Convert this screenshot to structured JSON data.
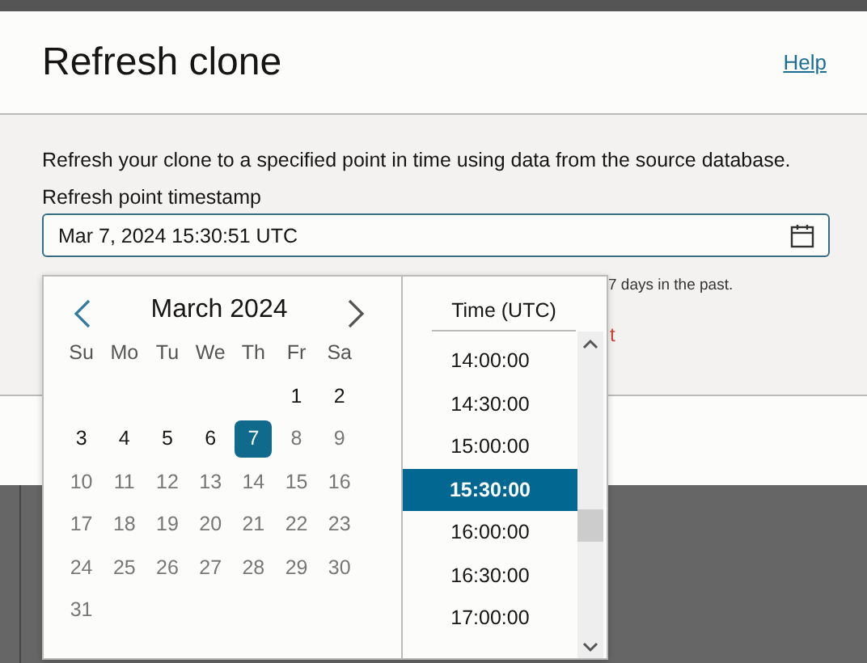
{
  "dialog": {
    "title": "Refresh clone",
    "help_link": "Help"
  },
  "description": "Refresh your clone to a specified point in time using data from the source database.",
  "field": {
    "label": "Refresh point timestamp",
    "value": "Mar 7, 2024 15:30:51 UTC"
  },
  "hint_fragment": "7 days in the past.",
  "error_fragment": "t",
  "calendar": {
    "month": "March 2024",
    "weekdays": [
      "Su",
      "Mo",
      "Tu",
      "We",
      "Th",
      "Fr",
      "Sa"
    ],
    "days": [
      {
        "label": "1",
        "disabled": false,
        "selected": false
      },
      {
        "label": "2",
        "disabled": false,
        "selected": false
      },
      {
        "label": "3",
        "disabled": false,
        "selected": false
      },
      {
        "label": "4",
        "disabled": false,
        "selected": false
      },
      {
        "label": "5",
        "disabled": false,
        "selected": false
      },
      {
        "label": "6",
        "disabled": false,
        "selected": false
      },
      {
        "label": "7",
        "disabled": false,
        "selected": true
      },
      {
        "label": "8",
        "disabled": true,
        "selected": false
      },
      {
        "label": "9",
        "disabled": true,
        "selected": false
      },
      {
        "label": "10",
        "disabled": true,
        "selected": false
      },
      {
        "label": "11",
        "disabled": true,
        "selected": false
      },
      {
        "label": "12",
        "disabled": true,
        "selected": false
      },
      {
        "label": "13",
        "disabled": true,
        "selected": false
      },
      {
        "label": "14",
        "disabled": true,
        "selected": false
      },
      {
        "label": "15",
        "disabled": true,
        "selected": false
      },
      {
        "label": "16",
        "disabled": true,
        "selected": false
      },
      {
        "label": "17",
        "disabled": true,
        "selected": false
      },
      {
        "label": "18",
        "disabled": true,
        "selected": false
      },
      {
        "label": "19",
        "disabled": true,
        "selected": false
      },
      {
        "label": "20",
        "disabled": true,
        "selected": false
      },
      {
        "label": "21",
        "disabled": true,
        "selected": false
      },
      {
        "label": "22",
        "disabled": true,
        "selected": false
      },
      {
        "label": "23",
        "disabled": true,
        "selected": false
      },
      {
        "label": "24",
        "disabled": true,
        "selected": false
      },
      {
        "label": "25",
        "disabled": true,
        "selected": false
      },
      {
        "label": "26",
        "disabled": true,
        "selected": false
      },
      {
        "label": "27",
        "disabled": true,
        "selected": false
      },
      {
        "label": "28",
        "disabled": true,
        "selected": false
      },
      {
        "label": "29",
        "disabled": true,
        "selected": false
      },
      {
        "label": "30",
        "disabled": true,
        "selected": false
      },
      {
        "label": "31",
        "disabled": true,
        "selected": false
      }
    ]
  },
  "time_list": {
    "header": "Time (UTC)",
    "times": [
      {
        "label": "14:00:00",
        "selected": false
      },
      {
        "label": "14:30:00",
        "selected": false
      },
      {
        "label": "15:00:00",
        "selected": false
      },
      {
        "label": "15:30:00",
        "selected": true
      },
      {
        "label": "16:00:00",
        "selected": false
      },
      {
        "label": "16:30:00",
        "selected": false
      },
      {
        "label": "17:00:00",
        "selected": false
      }
    ]
  }
}
